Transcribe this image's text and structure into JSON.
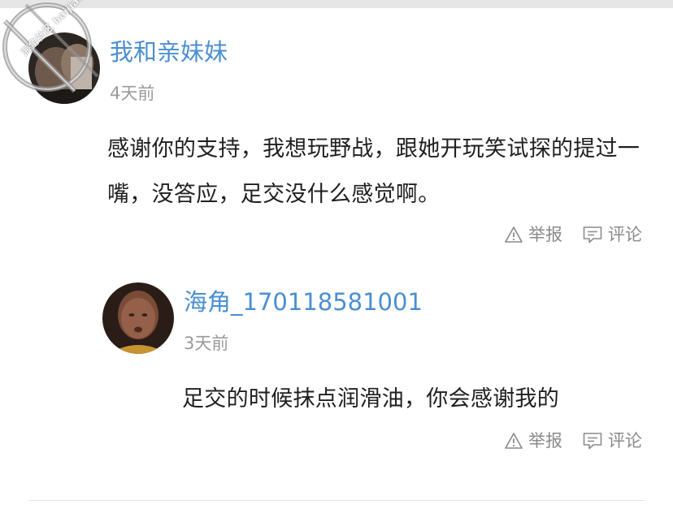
{
  "watermark": {
    "text": "海角社区 haijiao.com"
  },
  "comments": [
    {
      "username": "我和亲妹妹",
      "timestamp": "4天前",
      "body": "感谢你的支持，我想玩野战，跟她开玩笑试探的提过一嘴，没答应，足交没什么感觉啊。",
      "actions": {
        "report": "举报",
        "comment": "评论"
      }
    },
    {
      "username": "海角_170118581001",
      "timestamp": "3天前",
      "body": "足交的时候抹点润滑油，你会感谢我的",
      "actions": {
        "report": "举报",
        "comment": "评论"
      }
    }
  ],
  "colors": {
    "username": "#4b8fd1",
    "timestamp": "#9a9a9a",
    "body_text": "#1f1f1f",
    "action_text": "#8a8a8a"
  },
  "icons": {
    "report": "warning-triangle-icon",
    "comment": "speech-bubble-icon"
  }
}
